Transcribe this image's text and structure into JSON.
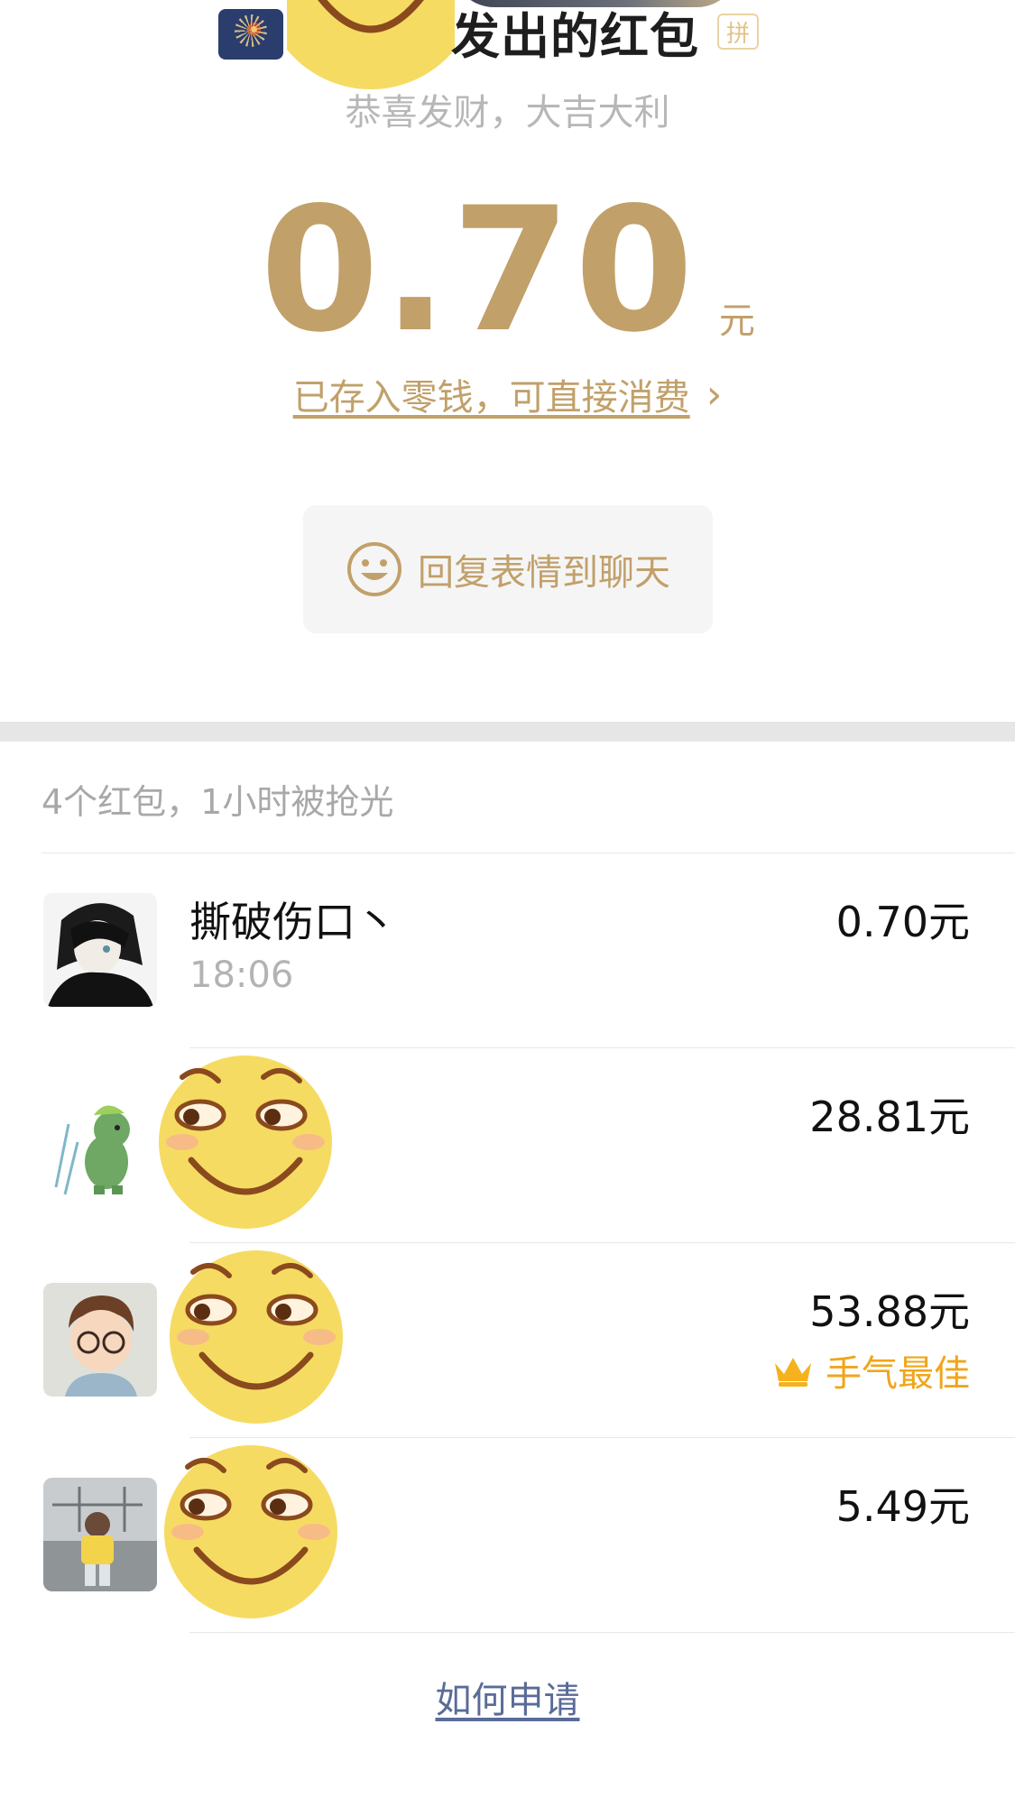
{
  "header": {
    "title": "发出的红包",
    "badge": "拼",
    "subtitle": "恭喜发财，大吉大利"
  },
  "amount": {
    "value": "0.70",
    "unit": "元"
  },
  "saved_link": {
    "label": "已存入零钱，可直接消费",
    "chevron": "›"
  },
  "reply_button": {
    "label": "回复表情到聊天"
  },
  "summary": "4个红包，1小时被抢光",
  "recipients": [
    {
      "name": "撕破伤口丶",
      "time": "18:06",
      "amount": "0.70元",
      "best": ""
    },
    {
      "name": "",
      "time": "",
      "amount": "28.81元",
      "best": ""
    },
    {
      "name": "",
      "time": "",
      "amount": "53.88元",
      "best": "手气最佳"
    },
    {
      "name": "",
      "time": "",
      "amount": "5.49元",
      "best": ""
    }
  ],
  "footer_link": "如何申请",
  "colors": {
    "gold": "#c1a06a",
    "best_orange": "#f0a51a",
    "link_blue": "#5a6b98"
  }
}
